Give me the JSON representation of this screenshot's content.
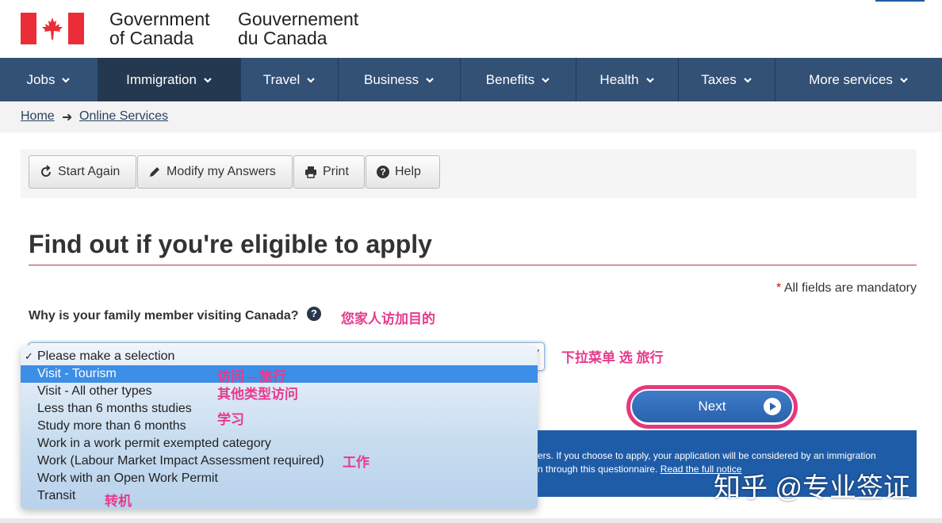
{
  "header": {
    "gov_en": [
      "Government",
      "of Canada"
    ],
    "gov_fr": [
      "Gouvernement",
      "du Canada"
    ]
  },
  "nav": {
    "items": [
      {
        "label": "Jobs"
      },
      {
        "label": "Immigration"
      },
      {
        "label": "Travel"
      },
      {
        "label": "Business"
      },
      {
        "label": "Benefits"
      },
      {
        "label": "Health"
      },
      {
        "label": "Taxes"
      },
      {
        "label": "More services"
      }
    ],
    "active_index": 1
  },
  "breadcrumb": {
    "home": "Home",
    "arrow": "➜",
    "online": "Online Services"
  },
  "toolbar": {
    "start_again": "Start Again",
    "modify": "Modify my Answers",
    "print": "Print",
    "help": "Help"
  },
  "page": {
    "heading": "Find out if you're eligible to apply",
    "mandatory_star": "*",
    "mandatory": "All fields are mandatory",
    "question": "Why is your family member visiting Canada?",
    "help_glyph": "?"
  },
  "dropdown": {
    "selected_index": 1,
    "check": "✓",
    "arrows": "▲▼",
    "options": [
      "Please make a selection",
      "Visit - Tourism",
      "Visit - All other types",
      "Less than 6 months studies",
      "Study more than 6 months",
      "Work in a work permit exempted category",
      "Work (Labour Market Impact Assessment required)",
      "Work with an Open Work Permit",
      "Transit"
    ]
  },
  "next": {
    "label": "Next"
  },
  "notice": {
    "line1": "ers. If you choose to apply, your application will be considered by an immigration",
    "line2_pre": "n through this questionnaire. ",
    "line2_link": "Read the full notice"
  },
  "annotations": {
    "purpose": "您家人访加目的",
    "menu": "下拉菜单  选 旅行",
    "visit_tourism": "访问 – 旅行",
    "visit_other": "其他类型访问",
    "study": "学习",
    "work": "工作",
    "transit": "转机"
  },
  "watermark": "知乎 @专业签证",
  "colors": {
    "nav_bg": "#335075",
    "nav_active": "#243850",
    "flag_red": "#eb2d37",
    "rule_red": "#af3c43",
    "annotation_pink": "#e63a8c",
    "selected_blue": "#3d8ee6",
    "notice_blue": "#1f5ca8"
  }
}
